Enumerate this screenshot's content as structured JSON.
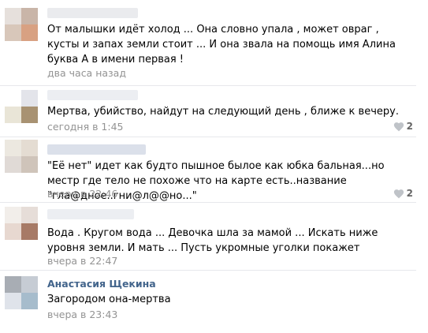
{
  "comments": [
    {
      "author_name": "",
      "avatar_colors": [
        "#e6e0dc",
        "#c9b5a8",
        "#d8c7ba",
        "#d8a182"
      ],
      "name_blur_color": "#eaebee",
      "text": "От малышки идёт холод ... Она словно упала , может овраг , кусты и запах земли стоит ... И она звала на помощь имя Алина буква А в имени первая !",
      "time": "два часа назад",
      "likes": ""
    },
    {
      "author_name": "",
      "avatar_colors": [
        "#ffffff",
        "#e3e4ea",
        "#e9e5d7",
        "#a89272"
      ],
      "name_blur_color": "#eceef2",
      "text": "Мертва, убийство, найдут на следующий день , ближе к вечеру.",
      "time": "сегодня в 1:45",
      "likes": "2"
    },
    {
      "author_name": "",
      "avatar_colors": [
        "#ece8e0",
        "#e4dcd2",
        "#e0dad6",
        "#cfc4ba"
      ],
      "name_blur_color": "#dbe0ea",
      "text": "\"Её нет\" идет как будто пышное былое как юбка бальная...но местр где тело не похоже что на карте есть..название \"гла@дное..гни@л@@но...\"",
      "time": "вчера в 22:46",
      "likes": "2"
    },
    {
      "author_name": "",
      "avatar_colors": [
        "#f2eeea",
        "#e6ddd8",
        "#e7d8d0",
        "#a77a66"
      ],
      "name_blur_color": "#eceef2",
      "text": "Вода . Кругом вода ... Девочка шла за мамой ... Искать ниже уровня земли. И мать ... Пусть укромные уголки покажет",
      "time": "вчера в 22:47",
      "likes": ""
    },
    {
      "author_name": "Анастасия Щекина",
      "avatar_colors": [
        "#a8adb4",
        "#c6ccd4",
        "#dfe3ea",
        "#a6bccc"
      ],
      "name_blur_color": "",
      "text": "Загородом она-мертва",
      "time": "вчера в 23:43",
      "likes": ""
    }
  ]
}
